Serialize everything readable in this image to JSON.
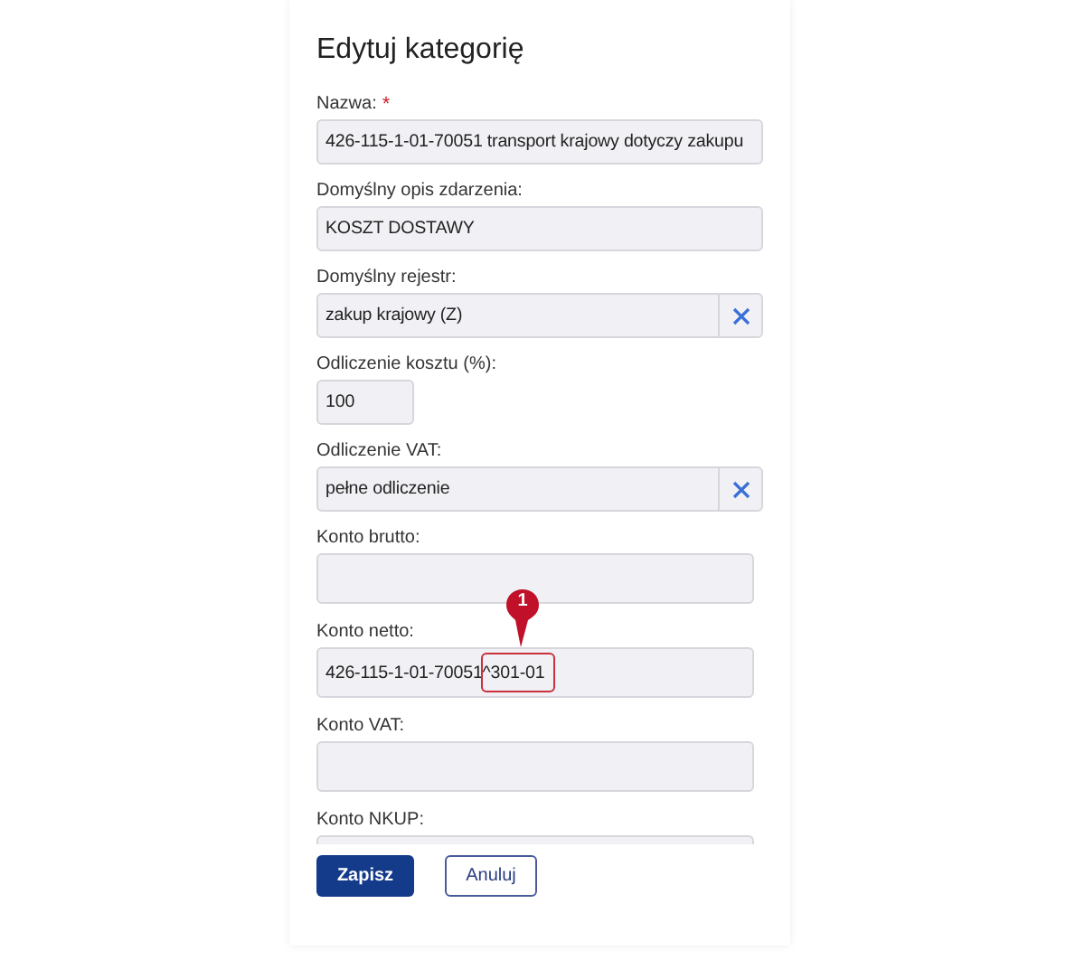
{
  "title": "Edytuj kategorię",
  "fields": [
    {
      "kind": "text",
      "label": "Nazwa:",
      "required_mark": "*",
      "value": "426-115-1-01-70051 transport krajowy dotyczy zakupu"
    },
    {
      "kind": "text",
      "label": "Domyślny opis zdarzenia:",
      "value": "KOSZT DOSTAWY"
    },
    {
      "kind": "select",
      "label": "Domyślny rejestr:",
      "value": "zakup krajowy (Z)"
    },
    {
      "kind": "number",
      "label": "Odliczenie kosztu (%):",
      "value": "100"
    },
    {
      "kind": "select",
      "label": "Odliczenie VAT:",
      "value": "pełne odliczenie"
    },
    {
      "kind": "text",
      "label": "Konto brutto:"
    },
    {
      "kind": "text",
      "label": "Konto netto:",
      "value": "426-115-1-01-70051^301-01",
      "annotation": "1"
    },
    {
      "kind": "text",
      "label": "Konto VAT:"
    },
    {
      "kind": "text",
      "label": "Konto NKUP:"
    }
  ],
  "buttons": [
    {
      "kind": "primary",
      "label": "Zapisz"
    },
    {
      "kind": "secondary",
      "label": "Anuluj"
    }
  ]
}
